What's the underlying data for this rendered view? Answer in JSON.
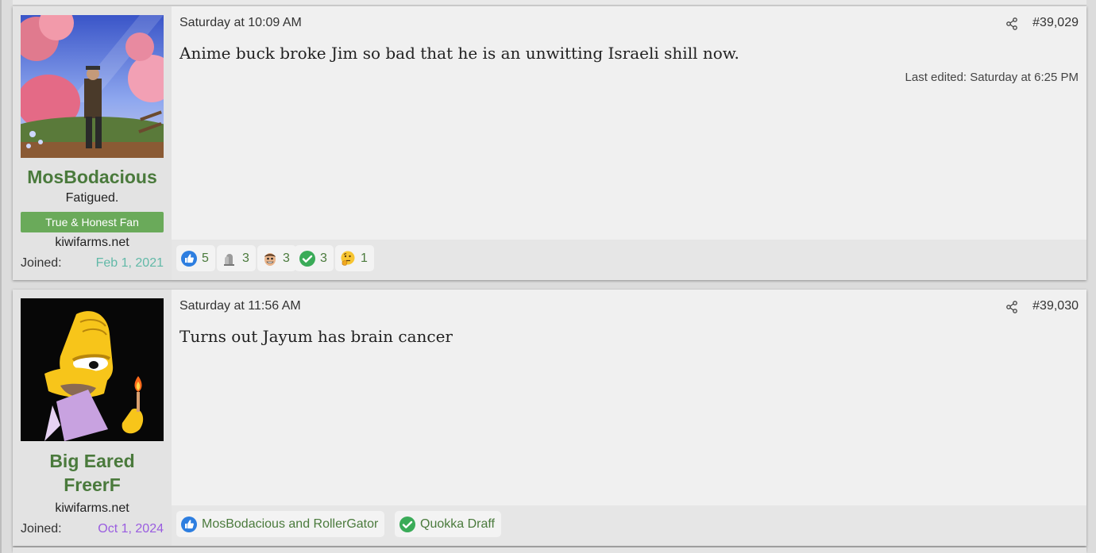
{
  "posts": [
    {
      "username": "MosBodacious",
      "user_title": "Fatigued.",
      "banner": "True & Honest Fan",
      "site": "kiwifarms.net",
      "joined_label": "Joined:",
      "joined_date": "Feb 1, 2021",
      "joined_color": "#62b9a8",
      "date": "Saturday at 10:09 AM",
      "post_number": "#39,029",
      "body": "Anime buck broke Jim so bad that he is an unwitting Israeli shill now.",
      "edited": "Last edited: Saturday at 6:25 PM",
      "reactions": [
        {
          "icon": "thumbs-up-icon",
          "count": "5"
        },
        {
          "icon": "tombstone-icon",
          "count": "3"
        },
        {
          "icon": "face-icon",
          "count": "3"
        },
        {
          "icon": "checkmark-icon",
          "count": "3"
        },
        {
          "icon": "thinking-emoji-icon",
          "count": "1"
        }
      ]
    },
    {
      "username": "Big Eared FreerF",
      "username_line1": "Big Eared",
      "username_line2": "FreerF",
      "site": "kiwifarms.net",
      "joined_label": "Joined:",
      "joined_date": "Oct 1, 2024",
      "joined_color": "#9a5de0",
      "date": "Saturday at 11:56 AM",
      "post_number": "#39,030",
      "body": "Turns out Jayum has brain cancer",
      "reactions": [
        {
          "icon": "thumbs-up-icon",
          "names": "MosBodacious and RollerGator"
        },
        {
          "icon": "checkmark-icon",
          "names": "Quokka Draff"
        }
      ]
    }
  ],
  "colors": {
    "username": "#4a7a3c",
    "banner_bg": "#6aaa5a",
    "reaction_text": "#4a7a3c"
  }
}
